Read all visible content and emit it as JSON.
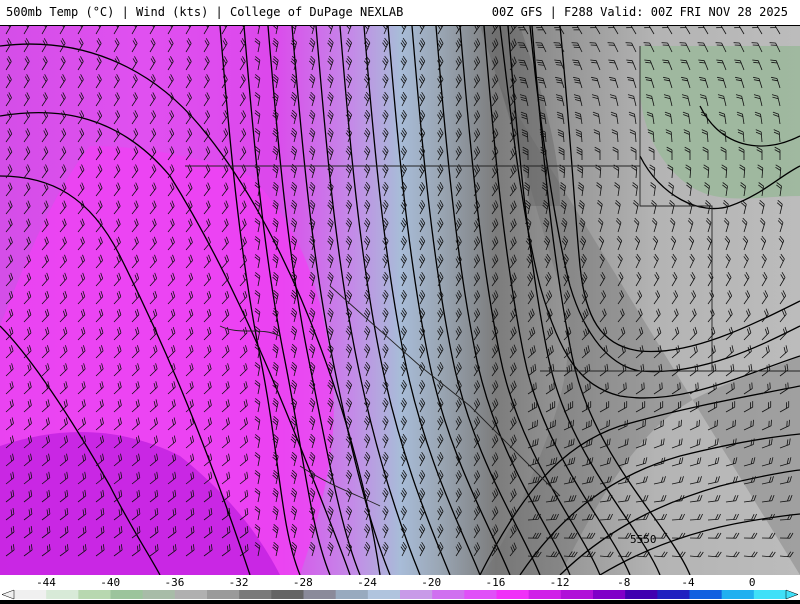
{
  "header": {
    "left_title": "500mb Temp (°C) | Wind (kts) | College of DuPage NEXLAB",
    "right_title": "00Z GFS | F288 Valid: 00Z FRI NOV 28 2025"
  },
  "map": {
    "contour_label": "5550"
  },
  "colorbar": {
    "ticks": [
      "-44",
      "-40",
      "-36",
      "-32",
      "-28",
      "-24",
      "-20",
      "-16",
      "-12",
      "-8",
      "-4",
      "0"
    ],
    "colors": [
      "#f0f0f0",
      "#d8ead8",
      "#b8d8b0",
      "#9cc49c",
      "#a8bca8",
      "#b0b0b0",
      "#9a9a9a",
      "#7a7a7a",
      "#646464",
      "#8a8a9a",
      "#98aabf",
      "#b0c4de",
      "#c89ae8",
      "#d070f0",
      "#e050f8",
      "#f030f8",
      "#d020e8",
      "#b010d8",
      "#8000c8",
      "#4000b0",
      "#2020c0",
      "#1060e0",
      "#20b0f0",
      "#40e0f8"
    ]
  }
}
